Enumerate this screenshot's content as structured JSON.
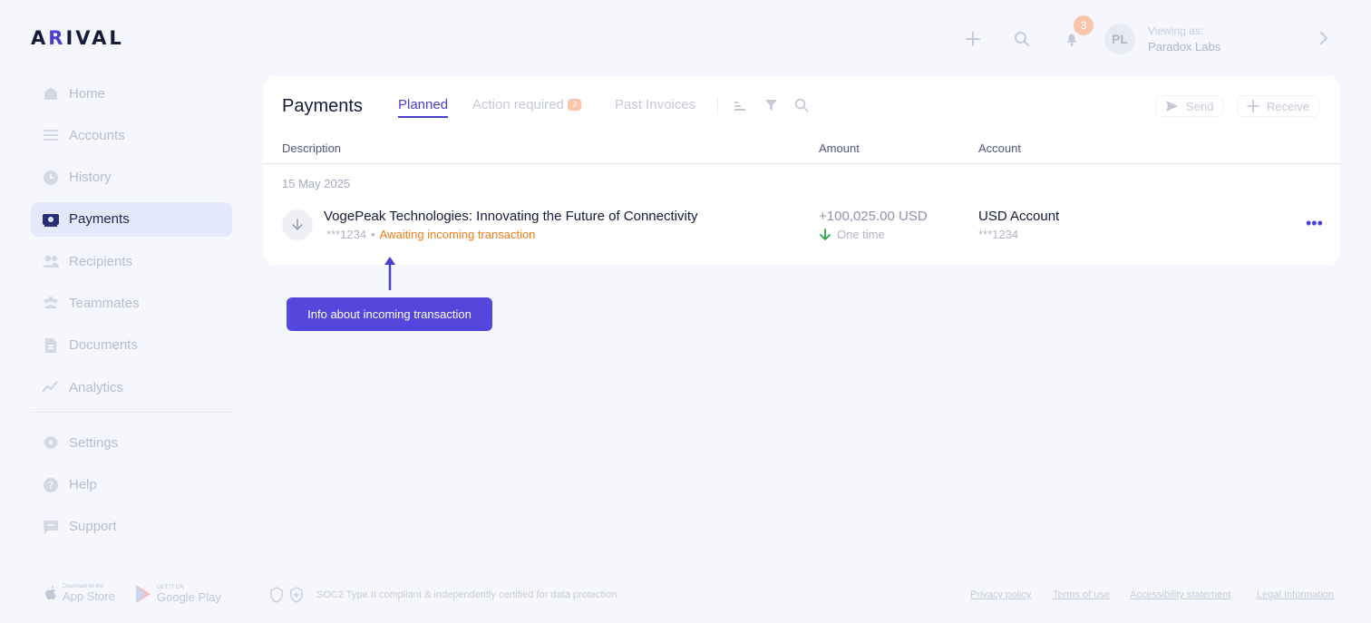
{
  "brand": {
    "logo_pre": "A",
    "logo_accent": "R",
    "logo_post": "IVAL"
  },
  "header": {
    "notification_count": "3",
    "viewer_label": "Viewing as:",
    "viewer_org": "Paradox Labs",
    "viewer_initials": "PL"
  },
  "sidebar": {
    "items": [
      {
        "label": "Home",
        "icon": "home-icon"
      },
      {
        "label": "Accounts",
        "icon": "accounts-icon"
      },
      {
        "label": "History",
        "icon": "history-icon"
      },
      {
        "label": "Payments",
        "icon": "payments-icon",
        "active": true
      },
      {
        "label": "Recipients",
        "icon": "recipients-icon"
      },
      {
        "label": "Teammates",
        "icon": "teammates-icon"
      },
      {
        "label": "Documents",
        "icon": "documents-icon"
      },
      {
        "label": "Analytics",
        "icon": "analytics-icon"
      }
    ],
    "bottom_items": [
      {
        "label": "Settings",
        "icon": "settings-icon"
      },
      {
        "label": "Help",
        "icon": "help-icon"
      },
      {
        "label": "Support",
        "icon": "support-icon"
      }
    ],
    "app_store": {
      "small": "Download on the",
      "big": "App Store"
    },
    "google_play": {
      "small": "GET IT ON",
      "big": "Google Play"
    }
  },
  "payments": {
    "title": "Payments",
    "tabs": [
      {
        "label": "Planned",
        "active": true
      },
      {
        "label": "Action required",
        "badge": "2"
      },
      {
        "label": "Past Invoices"
      }
    ],
    "send_label": "Send",
    "receive_label": "Receive",
    "columns": {
      "description": "Description",
      "amount": "Amount",
      "account": "Account"
    },
    "date_group": "15 May 2025",
    "row": {
      "description": "VogePeak Technologies: Innovating the Future of Connectivity",
      "ref": "***1234",
      "separator": "•",
      "status": "Awaiting incoming transaction",
      "amount": "+100,025.00 USD",
      "frequency": "One time",
      "account_name": "USD Account",
      "account_number": "***1234",
      "more": "•••"
    }
  },
  "annotation": {
    "text": "Info about incoming transaction"
  },
  "footer": {
    "compliance": "SOC2 Type II compliant & independently certified for data protection",
    "links": [
      "Privacy policy",
      "Terms of use",
      "Accessibility statement",
      "Legal Information"
    ]
  },
  "colors": {
    "accent": "#4a3fd1",
    "status_orange": "#f07c15",
    "success_green": "#27a844",
    "background": "#f5f7fd"
  }
}
